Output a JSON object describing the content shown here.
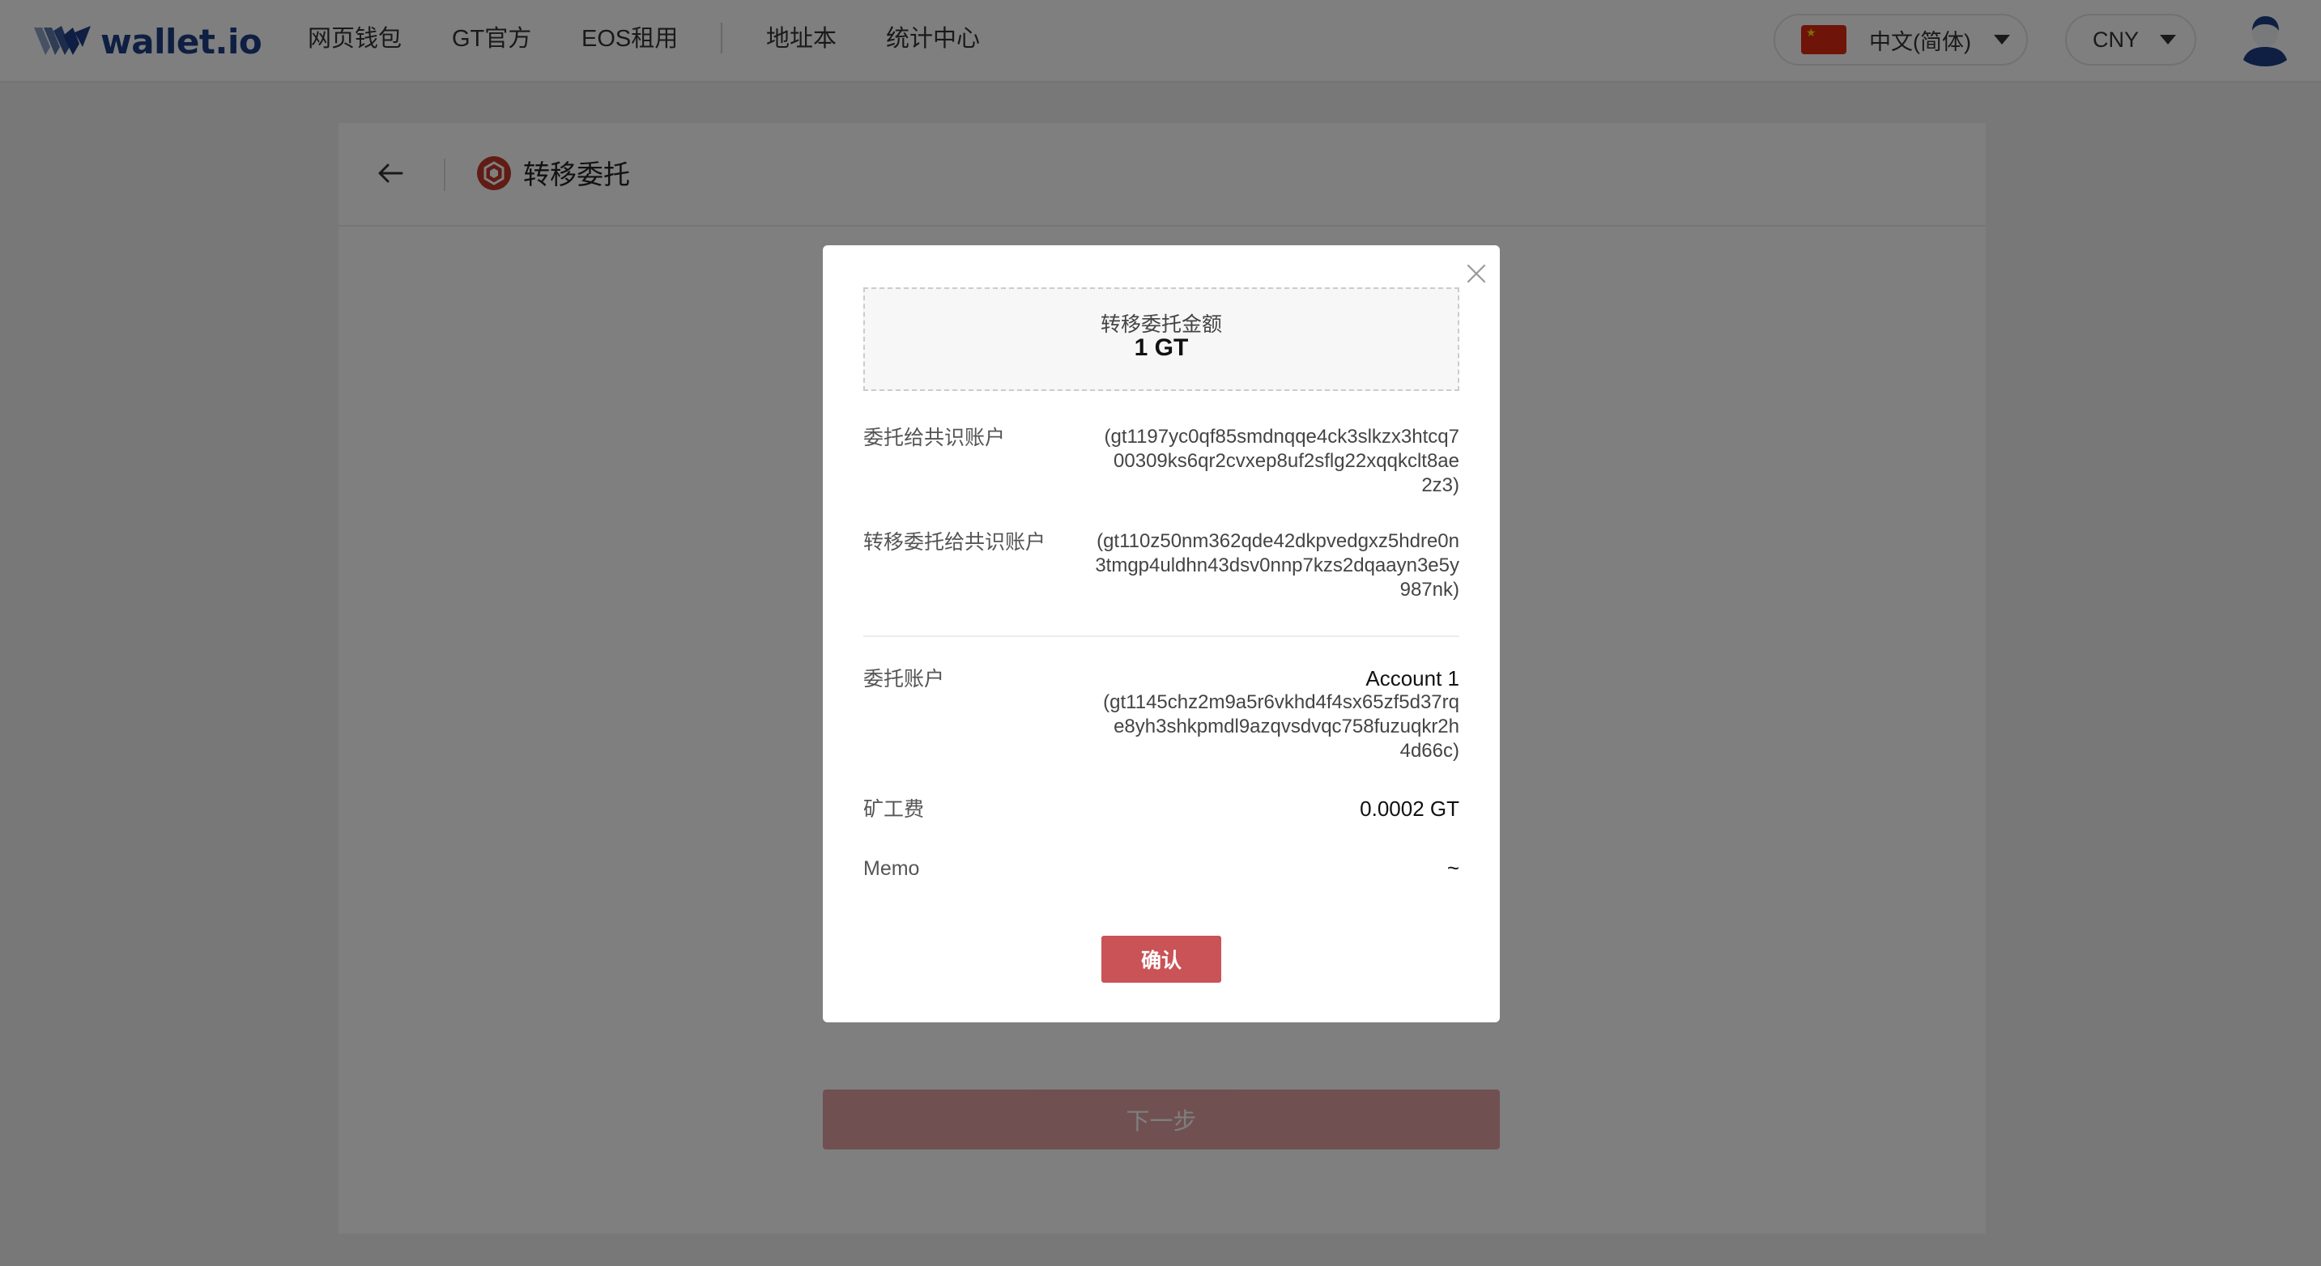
{
  "header": {
    "brand": "wallet.io",
    "nav": [
      "网页钱包",
      "GT官方",
      "EOS租用",
      "地址本",
      "统计中心"
    ],
    "language": "中文(简体)",
    "currency": "CNY",
    "icons": {
      "logo": "wallet-io-logo-icon",
      "flag": "china-flag-icon",
      "avatar": "user-avatar-icon",
      "caret": "chevron-down-icon"
    }
  },
  "page": {
    "title": "转移委托",
    "next_button": "下一步",
    "icons": {
      "back": "arrow-left-icon",
      "token": "gt-token-icon"
    }
  },
  "modal": {
    "amount_label": "转移委托金额",
    "amount_value": "1 GT",
    "rows": [
      {
        "label": "委托给共识账户",
        "value": "(gt1197yc0qf85smdnqqe4ck3slkzx3htcq700309ks6qr2cvxep8uf2sflg22xqqkclt8ae2z3)"
      },
      {
        "label": "转移委托给共识账户",
        "value": "(gt110z50nm362qde42dkpvedgxz5hdre0n3tmgp4uldhn43dsv0nnp7kzs2dqaayn3e5y987nk)"
      }
    ],
    "delegator": {
      "label": "委托账户",
      "account_name": "Account 1",
      "address": "(gt1145chz2m9a5r6vkhd4f4sx65zf5d37rqe8yh3shkpmdl9azqvsdvqc758fuzuqkr2h4d66c)"
    },
    "fee": {
      "label": "矿工费",
      "value": "0.0002 GT"
    },
    "memo": {
      "label": "Memo",
      "value": "~"
    },
    "confirm_button": "确认",
    "close_icon": "close-icon"
  },
  "colors": {
    "brand": "#1f3f86",
    "accent": "#c95356",
    "overlay": "rgba(0,0,0,0.5)"
  }
}
